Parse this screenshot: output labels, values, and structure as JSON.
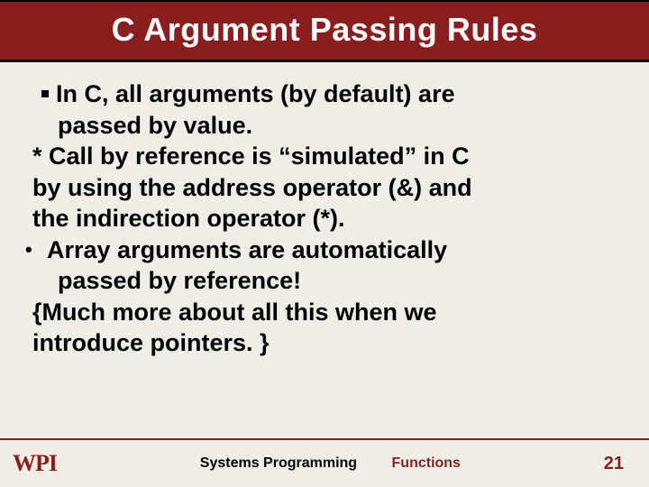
{
  "slide": {
    "title": "C Argument Passing Rules",
    "p1_a": "In C, all arguments (by default) are",
    "p1_b": "passed by value.",
    "p2_a": "* Call by reference is “simulated” in C",
    "p2_b": "by using the address operator (&) and",
    "p2_c": "the indirection operator (*).",
    "p3_a": "Array arguments are automatically",
    "p3_b": "passed by reference!",
    "p4_a": "{Much more about all this when we",
    "p4_b": "introduce pointers. }"
  },
  "footer": {
    "logo": "WPI",
    "course": "Systems Programming",
    "topic": "Functions",
    "page": "21"
  }
}
